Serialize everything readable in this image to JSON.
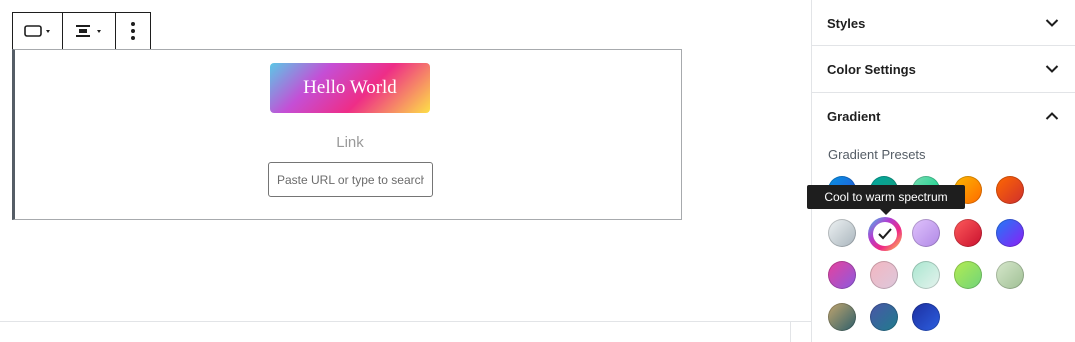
{
  "block": {
    "button_text": "Hello World",
    "link_label": "Link",
    "url_placeholder": "Paste URL or type to search"
  },
  "toolbar": {
    "button_icon": "button-style-icon",
    "align_icon": "align-center-icon",
    "more_icon": "more-vertical-icon"
  },
  "sidebar": {
    "panels": [
      {
        "title": "Styles",
        "state": "collapsed",
        "icon": "chevron-down-icon"
      },
      {
        "title": "Color Settings",
        "state": "collapsed",
        "icon": "chevron-down-icon"
      },
      {
        "title": "Gradient",
        "state": "expanded",
        "icon": "chevron-up-icon"
      }
    ],
    "presets_label": "Gradient Presets",
    "tooltip": "Cool to warm spectrum",
    "selected_preset": "Cool to warm spectrum",
    "swatch_colors": [
      [
        "#2a6fd8",
        "#1aa37a",
        "#25c28a",
        "#ff9a00",
        "#e4400f"
      ],
      [
        "#cfd6dc",
        "#selected",
        "#c9a5ee",
        "#e5202a",
        "#3a4df0"
      ],
      [
        "#c94fb0",
        "#e8bacb",
        "#c3e5da",
        "#8fd96a",
        "#b9d4b0"
      ],
      [
        "#6b8f73",
        "#3a3f8f",
        "#1b3cb0"
      ]
    ]
  },
  "colors": {
    "accent": "#1e1e1e",
    "border": "#e2e4e7",
    "block_left_border": "#555d66"
  }
}
